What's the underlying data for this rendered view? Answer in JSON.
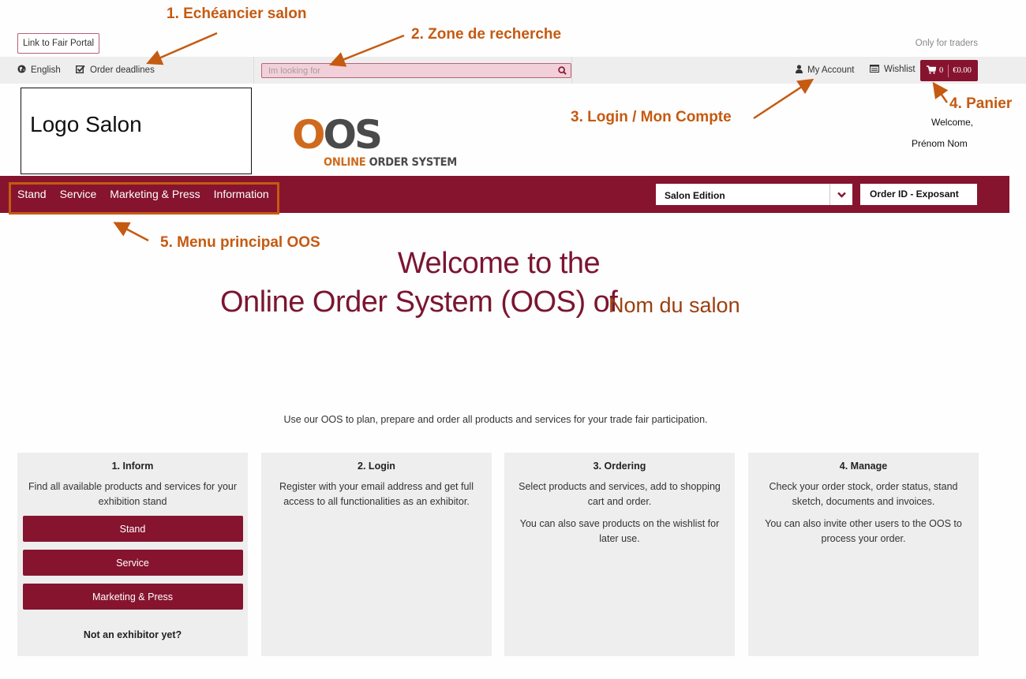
{
  "top_strip": {
    "fair_portal_label": "Link to Fair Portal",
    "only_traders": "Only for traders"
  },
  "utility_bar": {
    "language": {
      "icon": "globe-icon",
      "label": "English"
    },
    "deadlines": {
      "icon": "checkbox-icon",
      "label": "Order deadlines"
    },
    "search": {
      "placeholder": "Im looking for",
      "value": "",
      "icon": "search-icon"
    },
    "account": {
      "icon": "user-icon",
      "label": "My Account"
    },
    "wishlist": {
      "icon": "list-icon",
      "label": "Wishlist"
    },
    "cart": {
      "icon": "cart-icon",
      "count": "0",
      "total": "€0.00"
    }
  },
  "header": {
    "logo_placeholder": "Logo Salon",
    "oos_logo": {
      "mark": "OOS",
      "mark_first": "O",
      "mark_rest": "OS",
      "sub_a": "ONLINE",
      "sub_b": "ORDER SYSTEM"
    },
    "welcome": "Welcome,",
    "user_name": "Prénom Nom"
  },
  "main_nav": {
    "items": [
      {
        "label": "Stand"
      },
      {
        "label": "Service"
      },
      {
        "label": "Marketing & Press"
      },
      {
        "label": "Information"
      }
    ],
    "edition_select": {
      "value": "Salon Edition"
    },
    "order_id": "Order ID - Exposant"
  },
  "hero": {
    "line1": "Welcome to the",
    "line2": "Online Order System (OOS) of",
    "fair_name": "Nom du salon",
    "tagline": "Use our OOS to plan, prepare and order all products and services for your trade fair participation."
  },
  "cards": [
    {
      "title": "1. Inform",
      "paragraphs": [
        "Find all available products and services for your exhibition stand"
      ],
      "buttons": [
        "Stand",
        "Service",
        "Marketing & Press"
      ],
      "footer": "Not an exhibitor yet?"
    },
    {
      "title": "2. Login",
      "paragraphs": [
        "Register with your email address and get full access to all functionalities as an exhibitor."
      ]
    },
    {
      "title": "3. Ordering",
      "paragraphs": [
        "Select products and services, add to shopping cart and order.",
        "You can also save products on the wishlist for later use."
      ]
    },
    {
      "title": "4. Manage",
      "paragraphs": [
        "Check your order stock, order status, stand sketch, documents and invoices.",
        "You can also invite other users to the OOS to process your order."
      ]
    }
  ],
  "annotations": [
    "1.  Echéancier salon",
    "2. Zone de recherche",
    "3. Login / Mon Compte",
    "4. Panier",
    "5. Menu principal OOS"
  ],
  "colors": {
    "brand": "#86142f",
    "annotation": "#c55a11",
    "card_bg": "#eeeeee",
    "search_bg": "#f2d0d9"
  }
}
